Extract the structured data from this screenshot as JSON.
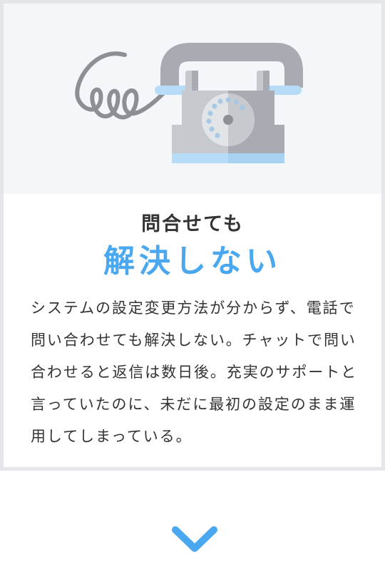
{
  "card": {
    "subheading": "問合せても",
    "heading": "解決しない",
    "description": "システムの設定変更方法が分からず、電話で問い合わせても解決しない。チャットで問い合わせると返信は数日後。充実のサポートと言っていたのに、未だに最初の設定のまま運用してしまっている。"
  },
  "illustration": {
    "icon": "telephone-icon",
    "background_color": "#f4f7fa"
  },
  "scroll_indicator": {
    "icon": "chevron-down-icon",
    "color": "#4aa8f0"
  },
  "colors": {
    "accent": "#4aa8f0",
    "text": "#333333",
    "border": "#e4e6ea"
  }
}
